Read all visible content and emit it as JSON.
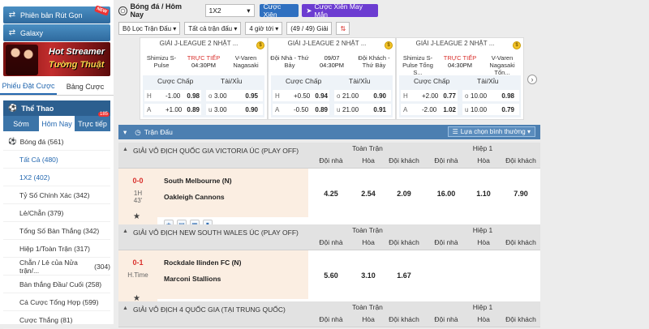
{
  "sidebar": {
    "btn1": "Phiên bản Rút Gọn",
    "btn1_badge": "NEW",
    "btn2": "Galaxy",
    "banner": {
      "line1": "Hot Streamer",
      "line2": "Tường Thuật"
    },
    "tabs": [
      "Phiếu Đặt Cược",
      "Bảng Cược"
    ],
    "sport_header": "Thể Thao",
    "sub_tabs": [
      "Sớm",
      "Hôm Nay",
      "Trực tiếp"
    ],
    "live_count": "185",
    "top_item": {
      "label": "Bóng đá",
      "count": "(561)"
    },
    "items": [
      {
        "label": "Tất Cả",
        "count": "(480)"
      },
      {
        "label": "1X2",
        "count": "(402)"
      },
      {
        "label": "Tỷ Số Chính Xác",
        "count": "(342)"
      },
      {
        "label": "Lẻ/Chẵn",
        "count": "(379)"
      },
      {
        "label": "Tổng Số Bàn Thắng",
        "count": "(342)"
      },
      {
        "label": "Hiệp 1/Toàn Trận",
        "count": "(317)"
      },
      {
        "label": "Chẵn / Lẻ của Nửa trận/...",
        "count": "(304)"
      },
      {
        "label": "Bàn thắng Đầu/ Cuối",
        "count": "(258)"
      },
      {
        "label": "Cá Cược Tổng Hợp",
        "count": "(599)"
      },
      {
        "label": "Cược Thắng",
        "count": "(81)"
      }
    ]
  },
  "topbar": {
    "crumb": "Bóng đá / Hôm Nay",
    "market": "1X2",
    "btn_parlay": "Cược Xiên",
    "btn_lucky": "Cược Xiên May Mắn"
  },
  "filters": [
    "Bộ Lọc Trận Đấu",
    "Tất cả trận đấu",
    "4 giờ tới",
    "(49 / 49) Giải"
  ],
  "cards": [
    {
      "league": "GIẢI J-LEAGUE 2 NHẬT ...",
      "home": "Shimizu S-Pulse",
      "away": "V-Varen Nagasaki",
      "status": "TRỰC TIẾP",
      "time": "04:30PM",
      "h_label": "Cược Chấp",
      "t_label": "Tài/Xỉu",
      "rows": [
        {
          "l1": "H",
          "h": "-1.00",
          "ho": "0.98",
          "l2": "o",
          "t": "3.00",
          "to": "0.95"
        },
        {
          "l1": "A",
          "h": "+1.00",
          "ho": "0.89",
          "l2": "u",
          "t": "3.00",
          "to": "0.90"
        }
      ]
    },
    {
      "league": "GIẢI J-LEAGUE 2 NHẬT ...",
      "home": "Đội Nhà - Thứ Bảy",
      "away": "Đội Khách - Thứ Bảy",
      "status": "09/07",
      "time": "04:30PM",
      "h_label": "Cược Chấp",
      "t_label": "Tài/Xỉu",
      "rows": [
        {
          "l1": "H",
          "h": "+0.50",
          "ho": "0.94",
          "l2": "o",
          "t": "21.00",
          "to": "0.90"
        },
        {
          "l1": "A",
          "h": "-0.50",
          "ho": "0.89",
          "l2": "u",
          "t": "21.00",
          "to": "0.91"
        }
      ]
    },
    {
      "league": "GIẢI J-LEAGUE 2 NHẬT ...",
      "home": "Shimizu S-Pulse Tổng S...",
      "away": "V-Varen Nagasaki Tổn...",
      "status": "TRỰC TIẾP",
      "time": "04:30PM",
      "h_label": "Cược Chấp",
      "t_label": "Tài/Xỉu",
      "rows": [
        {
          "l1": "H",
          "h": "+2.00",
          "ho": "0.77",
          "l2": "o",
          "t": "10.00",
          "to": "0.98"
        },
        {
          "l1": "A",
          "h": "-2.00",
          "ho": "1.02",
          "l2": "u",
          "t": "10.00",
          "to": "0.79"
        }
      ]
    }
  ],
  "table": {
    "header": "Trận Đấu",
    "view_option": "Lựa chọn bình thường",
    "group_full": "Toàn Trận",
    "group_half": "Hiệp 1",
    "cols": [
      "Đội nhà",
      "Hòa",
      "Đội khách",
      "Đội nhà",
      "Hòa",
      "Đội khách"
    ],
    "leagues": [
      {
        "name": "GIẢI VÔ ĐỊCH QUỐC GIA VICTORIA ÚC (PLAY OFF)"
      },
      {
        "name": "GIẢI VÔ ĐỊCH NEW SOUTH WALES ÚC (PLAY OFF)"
      },
      {
        "name": "GIẢI VÔ ĐỊCH 4 QUỐC GIA (TẠI TRUNG QUỐC)"
      }
    ],
    "matches": [
      {
        "score": "0-0",
        "period": "1H",
        "minute": "43'",
        "home": "South Melbourne (N)",
        "away": "Oakleigh Cannons",
        "odds": [
          "4.25",
          "2.54",
          "2.09",
          "16.00",
          "1.10",
          "7.90"
        ]
      },
      {
        "score": "0-1",
        "period": "H.Time",
        "minute": "",
        "home": "Rockdale Ilinden FC (N)",
        "away": "Marconi Stallions",
        "odds": [
          "5.60",
          "3.10",
          "1.67"
        ]
      }
    ]
  },
  "colors": {
    "primary": "#2f70c0",
    "live": "#d9302c",
    "lucky": "#6c3cd1"
  }
}
